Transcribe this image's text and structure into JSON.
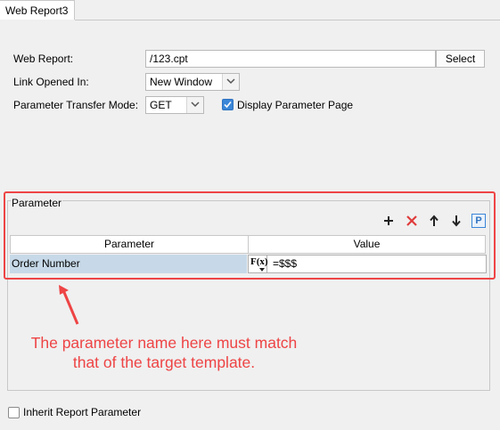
{
  "tab": {
    "title": "Web Report3"
  },
  "form": {
    "web_report_label": "Web Report:",
    "web_report_value": "/123.cpt",
    "select_button": "Select",
    "link_opened_label": "Link Opened In:",
    "link_opened_value": "New Window",
    "transfer_mode_label": "Parameter Transfer Mode:",
    "transfer_mode_value": "GET",
    "display_parameter_label": "Display Parameter Page",
    "display_parameter_checked": true
  },
  "parameter_group": {
    "title": "Parameter",
    "toolbar": {
      "add_icon": "plus-icon",
      "delete_icon": "x-icon",
      "move_up_icon": "arrow-up-icon",
      "move_down_icon": "arrow-down-icon",
      "param_icon": "p-icon",
      "param_icon_text": "P"
    },
    "columns": [
      "Parameter",
      "Value"
    ],
    "rows": [
      {
        "name": "Order Number",
        "value": "=$$$",
        "formula_label": "F(x)"
      }
    ]
  },
  "annotation": {
    "text": "The parameter name here must match that of the target template.",
    "color": "#ee4445"
  },
  "footer": {
    "inherit_label": "Inherit Report Parameter",
    "inherit_checked": false
  }
}
